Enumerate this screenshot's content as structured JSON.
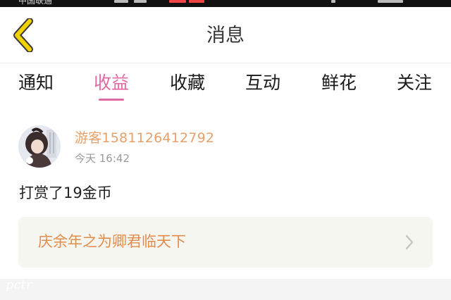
{
  "status_bar": {
    "carrier": "中国联通"
  },
  "header": {
    "title": "消息",
    "back_icon": "chevron-left-icon",
    "back_icon_color": "#f2d200"
  },
  "tabs": [
    {
      "label": "通知",
      "active": false
    },
    {
      "label": "收益",
      "active": true
    },
    {
      "label": "收藏",
      "active": false
    },
    {
      "label": "互动",
      "active": false
    },
    {
      "label": "鲜花",
      "active": false
    },
    {
      "label": "关注",
      "active": false
    }
  ],
  "message": {
    "username": "游客1581126412792",
    "time": "今天 16:42",
    "text": "打赏了19金币",
    "book": {
      "title": "庆余年之为卿君临天下",
      "arrow_icon": "chevron-right-icon"
    }
  },
  "watermark": "pctr",
  "colors": {
    "accent": "#e06aa2",
    "username": "#e8a06a",
    "book_title": "#e38c4c",
    "card_bg": "#f6f6f1"
  }
}
